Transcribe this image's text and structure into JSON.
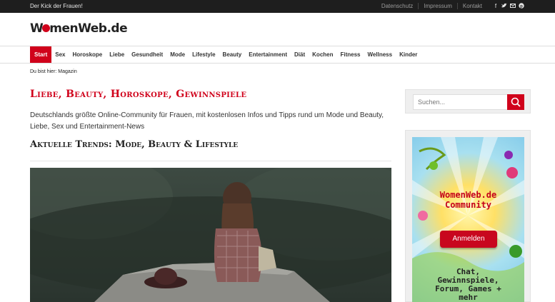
{
  "topbar": {
    "tagline": "Der Kick der Frauen!",
    "links": [
      "Datenschutz",
      "Impressum",
      "Kontakt"
    ],
    "social_icons": [
      "facebook-icon",
      "twitter-icon",
      "mail-icon",
      "pinterest-icon"
    ]
  },
  "header": {
    "logo_before": "W",
    "logo_after": "menWeb.de"
  },
  "nav": {
    "items": [
      "Start",
      "Sex",
      "Horoskope",
      "Liebe",
      "Gesundheit",
      "Mode",
      "Lifestyle",
      "Beauty",
      "Entertainment",
      "Diät",
      "Kochen",
      "Fitness",
      "Wellness",
      "Kinder"
    ],
    "active": "Start",
    "accent_color": "#d0021b"
  },
  "breadcrumb": "Du bist hier: Magazin",
  "main": {
    "title": "Liebe, Beauty, Horoskope, Gewinnspiele",
    "intro": "Deutschlands größte Online-Community für Frauen, mit kostenlosen Infos und Tipps rund um Mode und Beauty, Liebe, Sex und Entertainment-News",
    "section_title": "Aktuelle Trends: Mode, Beauty & Lifestyle"
  },
  "sidebar": {
    "search_placeholder": "Suchen...",
    "search_icon": "search-icon",
    "ad": {
      "title_line1": "WomenWeb.de",
      "title_line2": "Community",
      "button": "Anmelden",
      "bottom_line1": "Chat,",
      "bottom_line2": "Gewinnspiele,",
      "bottom_line3": "Forum, Games +",
      "bottom_line4": "mehr"
    }
  }
}
